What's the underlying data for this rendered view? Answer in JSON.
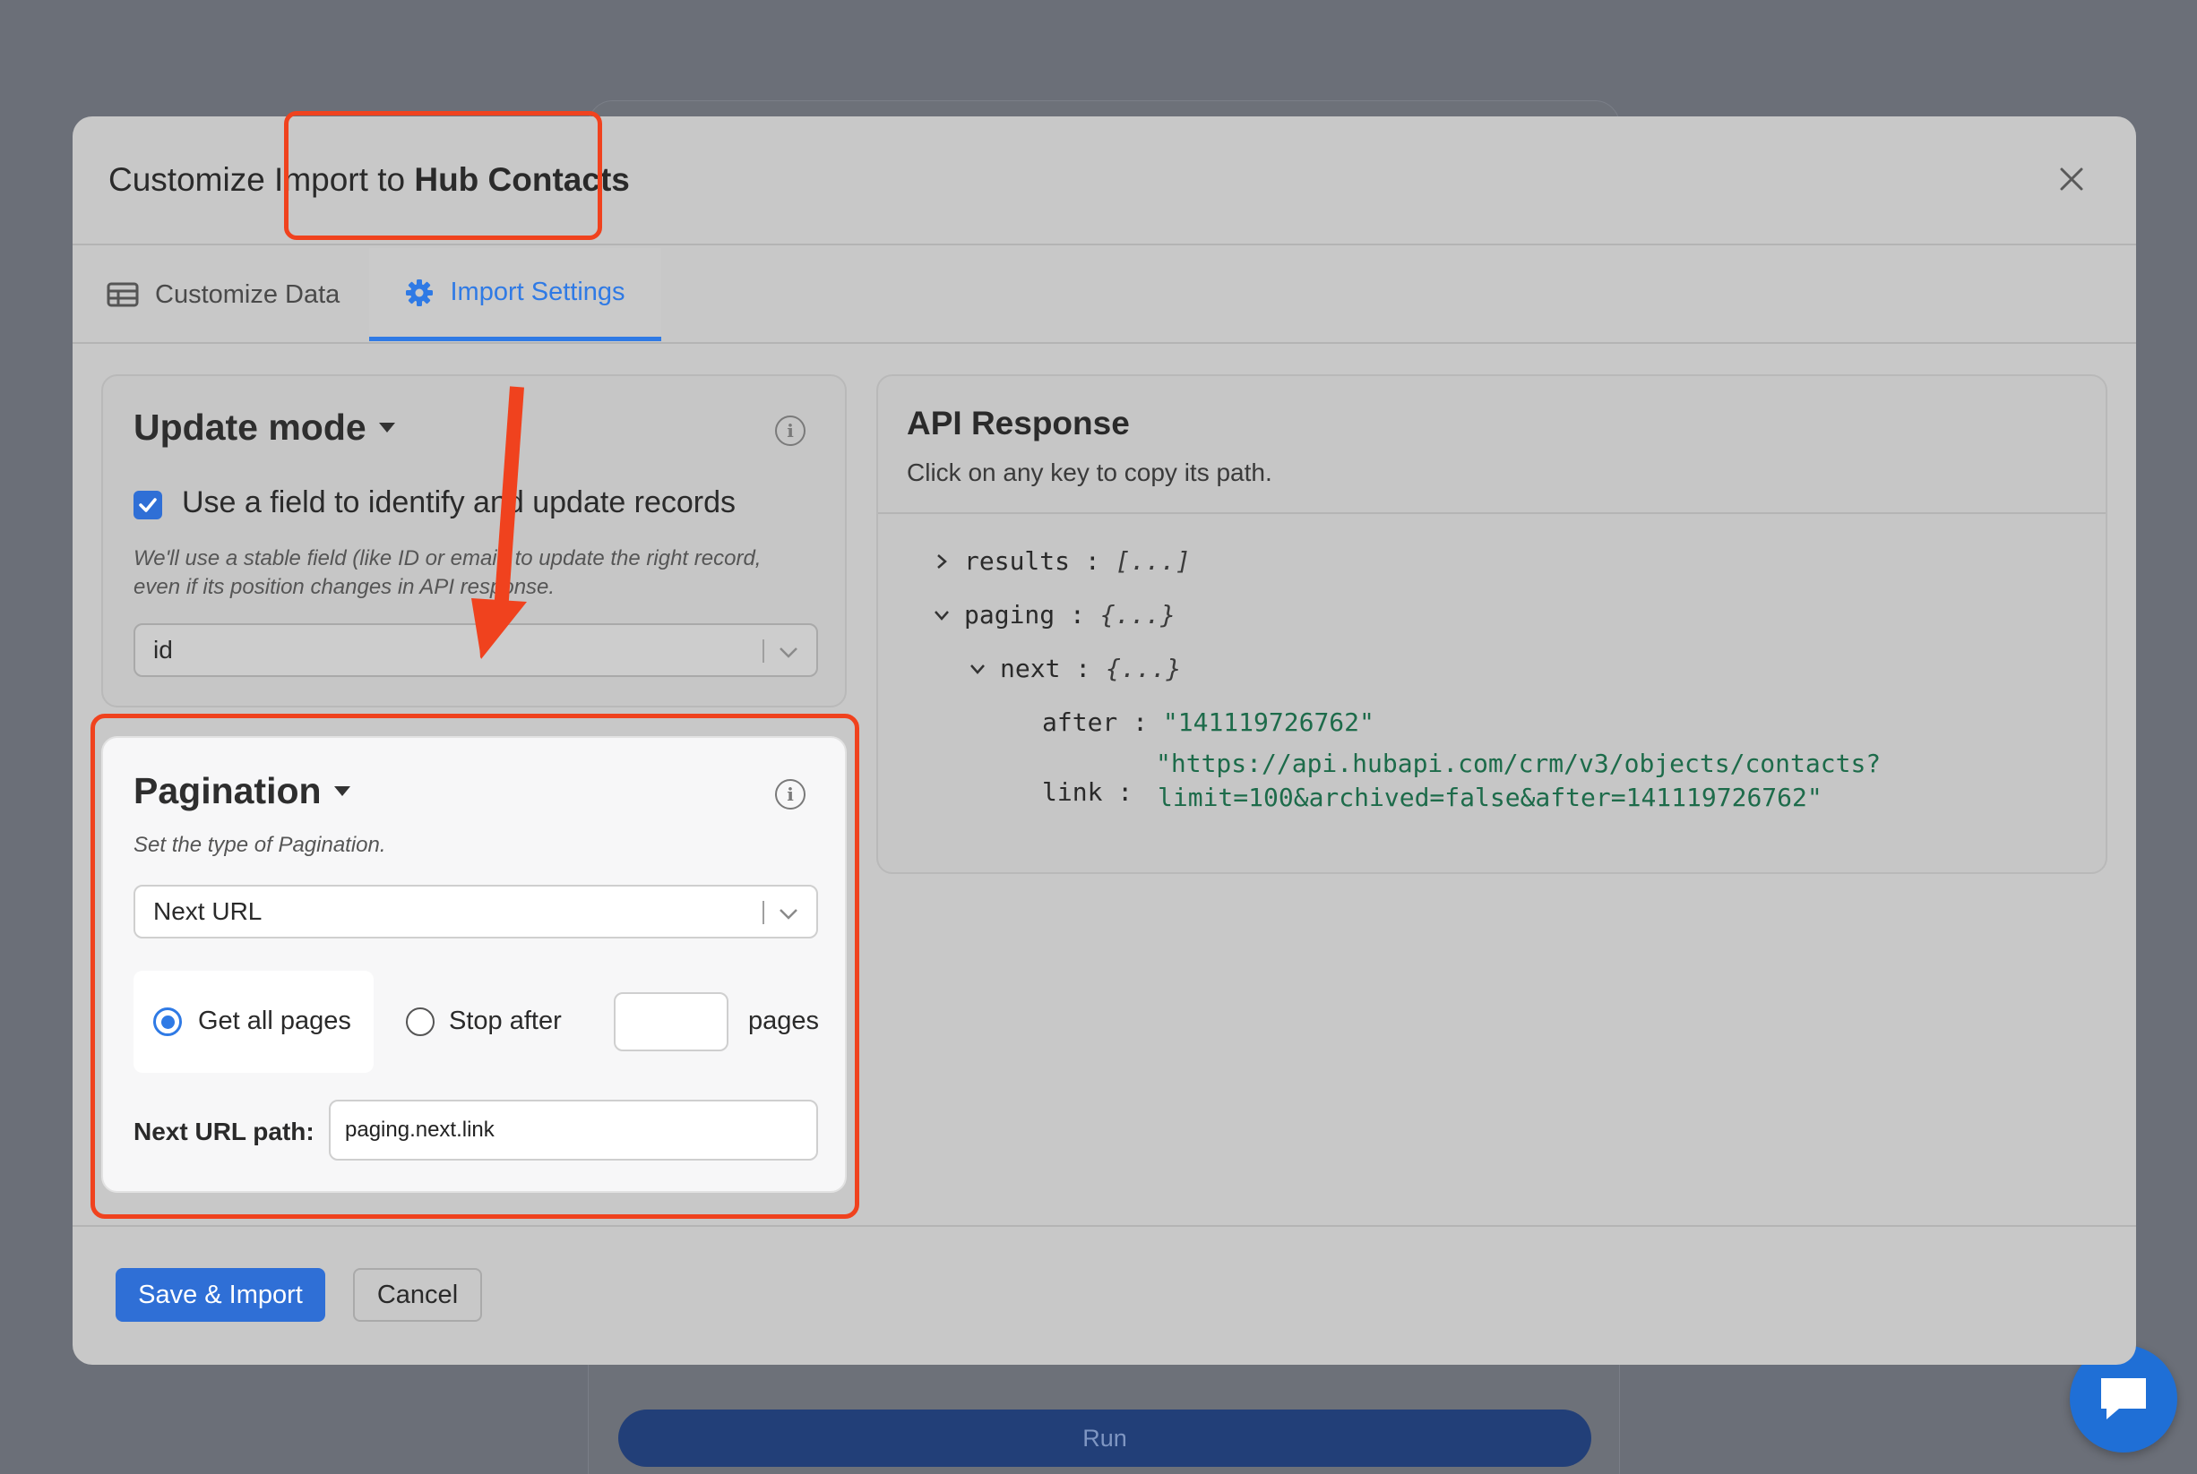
{
  "background": {
    "run_label": "Run"
  },
  "modal": {
    "title_prefix": "Customize Import to ",
    "title_strong": "Hub Contacts",
    "tabs": [
      {
        "label": "Customize Data",
        "icon": "table-icon"
      },
      {
        "label": "Import Settings",
        "icon": "gear-icon",
        "active": true
      }
    ]
  },
  "update_mode": {
    "title": "Update mode",
    "checkbox_label": "Use a field to identify and update records",
    "checkbox_checked": true,
    "helper_line1": "We'll use a stable field (like ID or email) to update the right record,",
    "helper_line2": "even if its position changes in API response.",
    "field_value": "id"
  },
  "pagination": {
    "title": "Pagination",
    "helper": "Set the type of Pagination.",
    "type_value": "Next URL",
    "radio_all_label": "Get all pages",
    "radio_stop_label": "Stop after",
    "pages_label": "pages",
    "stop_after_value": "",
    "next_url_label": "Next URL path:",
    "next_url_value": "paging.next.link"
  },
  "api_response": {
    "title": "API Response",
    "subtitle": "Click on any key to copy its path.",
    "tree": {
      "results_key": "results",
      "results_val": "[...]",
      "paging_key": "paging",
      "paging_val": "{...}",
      "next_key": "next",
      "next_val": "{...}",
      "after_key": "after",
      "after_val": "\"141119726762\"",
      "link_key": "link",
      "link_val_line1": "\"https://api.hubapi.com/crm/v3/objects/contacts?",
      "link_val_line2": "limit=100&archived=false&after=141119726762\""
    }
  },
  "footer": {
    "save_label": "Save & Import",
    "cancel_label": "Cancel"
  },
  "colors": {
    "accent": "#2f7ae5",
    "highlight": "#f0421e",
    "string": "#1d6b4a"
  }
}
